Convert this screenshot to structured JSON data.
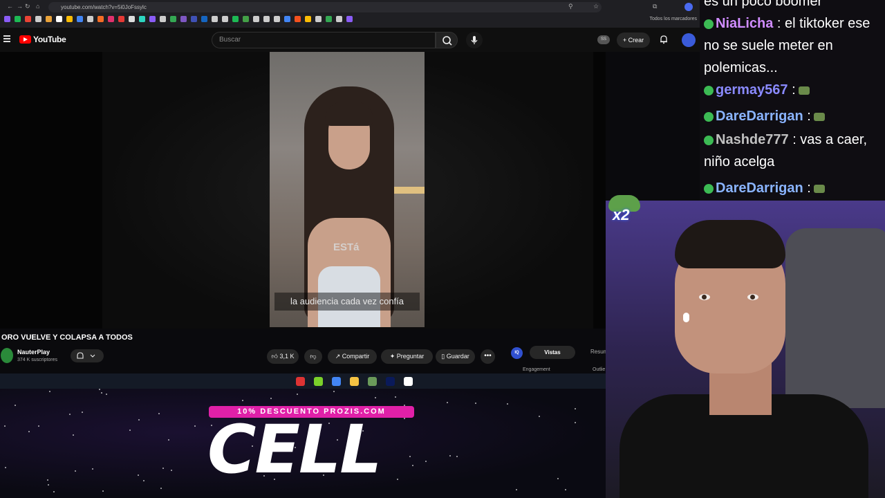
{
  "browser": {
    "url": "youtube.com/watch?v=5i0JoFssylc",
    "bookmarks_folder": "Todos los marcadores",
    "bookmark_colors": [
      "#8a5cf6",
      "#1db954",
      "#ea4335",
      "#cccccc",
      "#e8a23a",
      "#ffffff",
      "#fbbc05",
      "#4285f4",
      "#cccccc",
      "#f46c25",
      "#e1306c",
      "#e53935",
      "#dddddd",
      "#2dd4bf",
      "#8a5cf6",
      "#cccccc",
      "#34a853",
      "#7e57c2",
      "#3f51b5",
      "#1565c0",
      "#cccccc",
      "#cccccc",
      "#1db954",
      "#43a047",
      "#cccccc",
      "#cccccc",
      "#cccccc",
      "#4285f4",
      "#f4511e",
      "#fbbc05",
      "#cccccc",
      "#34a853",
      "#cccccc",
      "#8a5cf6"
    ]
  },
  "youtube": {
    "logo_text": "YouTube",
    "search_placeholder": "Buscar",
    "ss_badge": "SS",
    "create_label": "+ Crear"
  },
  "video": {
    "subtitle_top": "ESTá",
    "subtitle_main": "la audiencia cada vez confía",
    "title": "ORO VUELVE Y COLAPSA A TODOS",
    "channel_name": "NauterPlay",
    "channel_subs": "374 K suscriptores",
    "like_count": "3,1 K",
    "share_label": "Compartir",
    "ask_label": "Preguntar",
    "save_label": "Guardar",
    "iq_label": "IQ",
    "tab_vistas": "Vistas",
    "tab_resumen": "Resum",
    "engagement_label": "Engagement",
    "outlier_label": "Outlie"
  },
  "taskbar": {
    "icon_colors": [
      "#d33",
      "#7bd12a",
      "#4285f4",
      "#f6c343",
      "#6a9a5a",
      "#0a1a5a",
      "#ffffff"
    ]
  },
  "overlay": {
    "promo_text": "10% DESCUENTO PROZIS.COM",
    "cell_text": "CELL",
    "promo_color": "#e020a8"
  },
  "chat": {
    "messages": [
      {
        "user": "",
        "text": "es un poco boomer",
        "color": "#ffffff"
      },
      {
        "user": "NiaLicha",
        "text": ": el tiktoker ese no se suele meter en polemicas...",
        "color": "#d08cff"
      },
      {
        "user": "germay567",
        "text": ":",
        "color": "#8a8aff"
      },
      {
        "user": "DareDarrigan",
        "text": ":",
        "color": "#8ab4ff"
      },
      {
        "user": "Nashde777",
        "text": ": vas a caer, niño acelga",
        "color": "#c0c0c0"
      },
      {
        "user": "DareDarrigan",
        "text": ":",
        "color": "#8ab4ff"
      }
    ]
  },
  "cam": {
    "multiplier": "x2"
  }
}
